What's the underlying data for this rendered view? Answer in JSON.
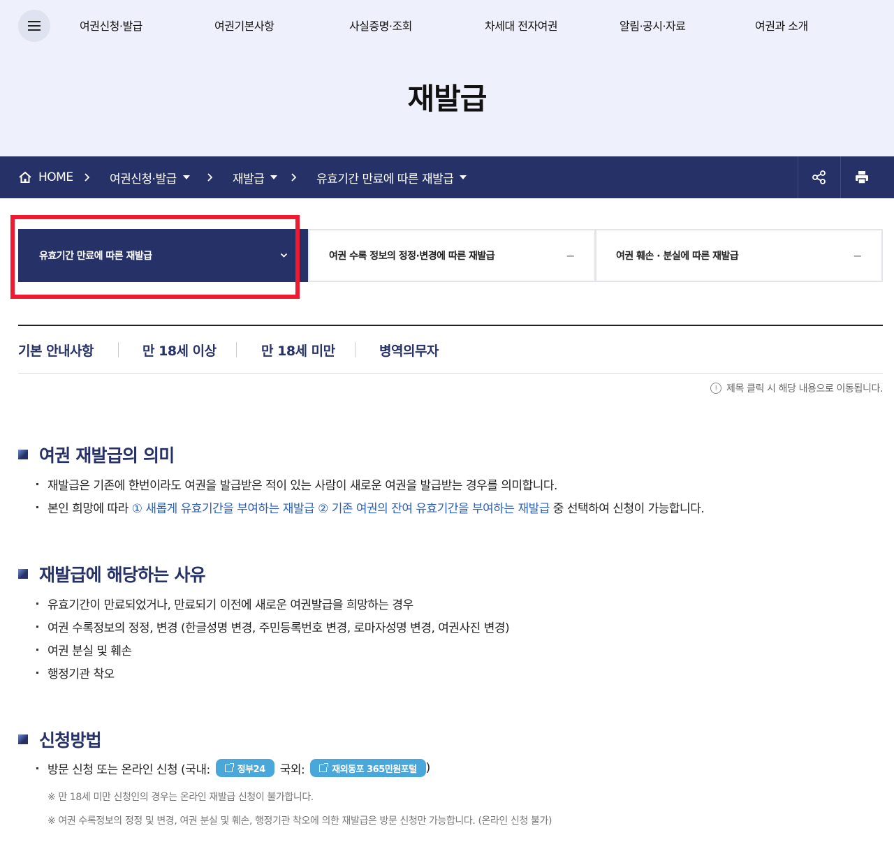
{
  "gnb": {
    "items": [
      "여권신청·발급",
      "여권기본사항",
      "사실증명·조회",
      "차세대 전자여권",
      "알림·공시·자료",
      "여권과 소개"
    ]
  },
  "page": {
    "title": "재발급"
  },
  "breadcrumb": {
    "home": "HOME",
    "items": [
      "여권신청·발급",
      "재발급",
      "유효기간 만료에 따른 재발급"
    ]
  },
  "tabs": [
    {
      "label": "유효기간 만료에 따른 재발급",
      "active": true
    },
    {
      "label": "여권 수록 정보의 정정·변경에 따른 재발급",
      "active": false
    },
    {
      "label": "여권 훼손 · 분실에 따른 재발급",
      "active": false
    }
  ],
  "subtabs": [
    "기본 안내사항",
    "만 18세 이상",
    "만 18세 미만",
    "병역의무자"
  ],
  "notice": "제목 클릭 시 해당 내용으로 이동됩니다.",
  "sections": {
    "meaning": {
      "title": "여권 재발급의 의미",
      "line1": "재발급은 기존에 한번이라도 여권을 발급받은 적이 있는 사람이 새로운 여권을 발급받는 경우를 의미합니다.",
      "line2_pre": "본인 희망에 따라 ",
      "line2_opt1": "① 새롭게 유효기간을 부여하는 재발급",
      "line2_opt2": "② 기존 여권의 잔여 유효기간을 부여하는 재발급",
      "line2_post": " 중 선택하여 신청이 가능합니다."
    },
    "reasons": {
      "title": "재발급에 해당하는 사유",
      "items": [
        "유효기간이 만료되었거나, 만료되기 이전에 새로운 여권발급을 희망하는 경우",
        "여권 수록정보의 정정, 변경 (한글성명 변경, 주민등록번호 변경, 로마자성명 변경, 여권사진 변경)",
        "여권 분실 및 훼손",
        "행정기관 착오"
      ]
    },
    "method": {
      "title": "신청방법",
      "line_pre": "방문 신청 또는 온라인 신청 (국내:",
      "btn_domestic": "정부24",
      "line_mid": "국외:",
      "btn_overseas": "재외동포 365민원포털",
      "line_post": ")",
      "note1": "※ 만 18세 미만 신청인의 경우는 온라인 재발급 신청이 불가합니다.",
      "note2": "※ 여권 수록정보의 정정 및 변경, 여권 분실 및 훼손, 행정기관 착오에 의한 재발급은 방문 신청만 가능합니다. (온라인 신청 불가)"
    }
  },
  "colors": {
    "navy": "#263167",
    "hero_bg": "#eef0fb",
    "link_blue": "#2c5fb8",
    "pill": "#4aa7d9",
    "highlight": "#ef1a2f"
  }
}
